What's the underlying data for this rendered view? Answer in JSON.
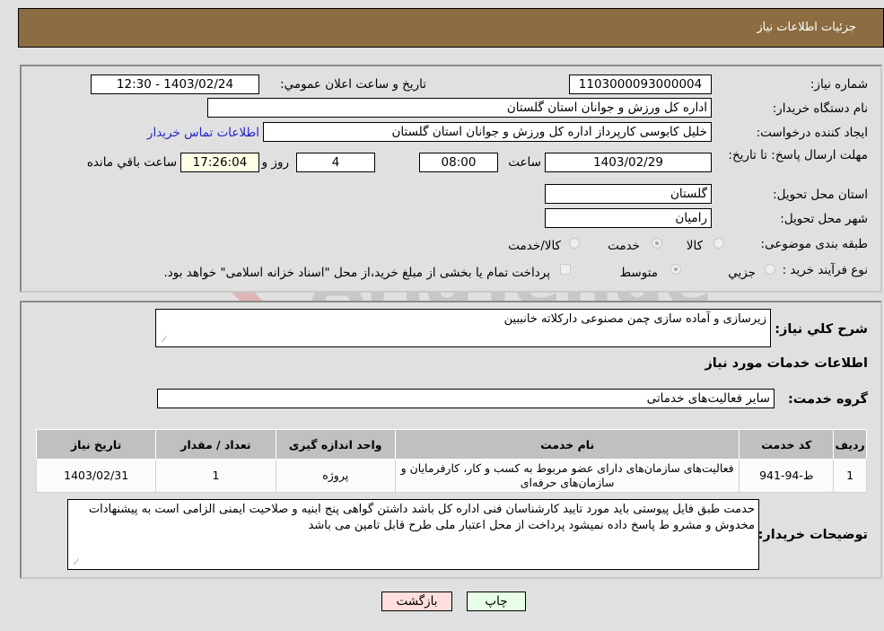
{
  "header": {
    "title": "جزئیات اطلاعات نیاز"
  },
  "details": {
    "need_number": {
      "label": "شماره نیاز:",
      "value": "1103000093000004"
    },
    "announce_datetime": {
      "label": "تاریخ و ساعت اعلان عمومي:",
      "value": "1403/02/24 - 12:30"
    },
    "buyer_org": {
      "label": "نام دستگاه خریدار:",
      "value": "اداره کل ورزش و جوانان استان گلستان"
    },
    "requester": {
      "label": "ایجاد کننده درخواست:",
      "value": "خلیل کابوسی کارپرداز اداره کل ورزش و جوانان استان گلستان"
    },
    "buyer_contact_link": "اطلاعات تماس خریدار",
    "deadline": {
      "label": "مهلت ارسال پاسخ: تا تاریخ:",
      "date": "1403/02/29",
      "time_label": "ساعت",
      "time": "08:00",
      "days": "4",
      "days_label": "روز و",
      "remaining": "17:26:04",
      "remaining_label": "ساعت باقي مانده"
    },
    "province": {
      "label": "استان محل تحویل:",
      "value": "گلستان"
    },
    "city": {
      "label": "شهر محل تحویل:",
      "value": "رامیان"
    },
    "category": {
      "label": "طبقه بندی موضوعی:",
      "options": [
        "کالا",
        "خدمت",
        "کالا/خدمت"
      ],
      "selected": "خدمت"
    },
    "purchase_type": {
      "label": "نوع فرآیند خرید :",
      "options": [
        "جزيي",
        "متوسط"
      ],
      "selected": "متوسط",
      "treasury_note": "پرداخت تمام یا بخشی از مبلغ خرید،از محل \"اسناد خزانه اسلامی\" خواهد بود."
    }
  },
  "summary": {
    "label": "شرح کلي نیاز:",
    "value": "زیرسازی و آماده سازی چمن مصنوعی دارکلاته خانببین"
  },
  "services": {
    "section_title": "اطلاعات خدمات مورد نیاز",
    "group_label": "گروه خدمت:",
    "group_value": "سایر فعالیت‌های خدماتی",
    "columns": [
      "ردیف",
      "کد خدمت",
      "نام خدمت",
      "واحد اندازه گیری",
      "تعداد / مقدار",
      "تاریخ نیاز"
    ],
    "rows": [
      {
        "index": "1",
        "code": "ط-94-941",
        "name": "فعالیت‌های سازمان‌های دارای عضو مربوط به کسب و کار، کارفرمایان و سازمان‌های حرفه‌ای",
        "unit": "پروژه",
        "quantity": "1",
        "date": "1403/02/31"
      }
    ]
  },
  "buyer_notes": {
    "label": "توضیحات خریدار:",
    "value": "حدمت طبق فایل پیوستی باید مورد تایید کارشناسان فنی اداره کل باشد داشتن گواهی پنج ابنیه و صلاحیت ایمنی الزامی است به پیشنهادات مخدوش و مشرو ط پاسخ داده نمیشود پرداخت از محل اعتبار ملی طرح قابل تامین می باشد"
  },
  "buttons": {
    "back": "بازگشت",
    "print": "چاپ"
  },
  "colors": {
    "header_bg": "#8c6d42",
    "link": "#2323c8",
    "back_bg": "#ffdede",
    "print_bg": "#e6ffe6",
    "remaining_bg": "#ffffe6"
  }
}
